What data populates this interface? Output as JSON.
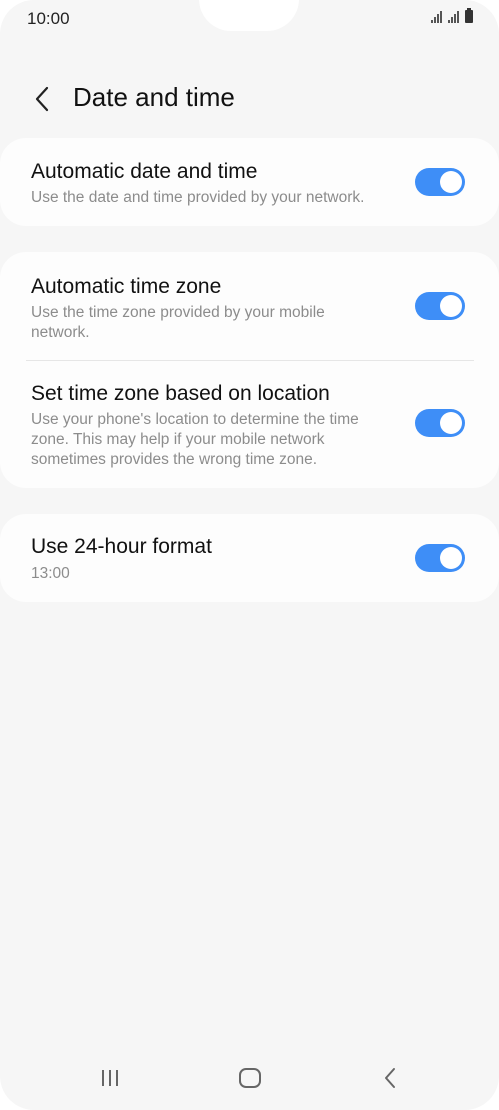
{
  "status": {
    "time": "10:00"
  },
  "header": {
    "title": "Date and time"
  },
  "settings": {
    "auto_datetime": {
      "title": "Automatic date and time",
      "subtitle": "Use the date and time provided by your network.",
      "on": true
    },
    "auto_timezone": {
      "title": "Automatic time zone",
      "subtitle": "Use the time zone provided by your mobile network.",
      "on": true
    },
    "location_timezone": {
      "title": "Set time zone based on location",
      "subtitle": "Use your phone's location to determine the time zone. This may help if your mobile network sometimes provides the wrong time zone.",
      "on": true
    },
    "hour24": {
      "title": "Use 24-hour format",
      "subtitle": "13:00",
      "on": true
    }
  },
  "colors": {
    "accent": "#3e8ef7",
    "background": "#f6f6f6",
    "card": "#fdfdfd"
  },
  "icons": {
    "back": "chevron-left-icon",
    "recents": "recents-icon",
    "home": "home-icon",
    "nav_back": "back-icon"
  }
}
